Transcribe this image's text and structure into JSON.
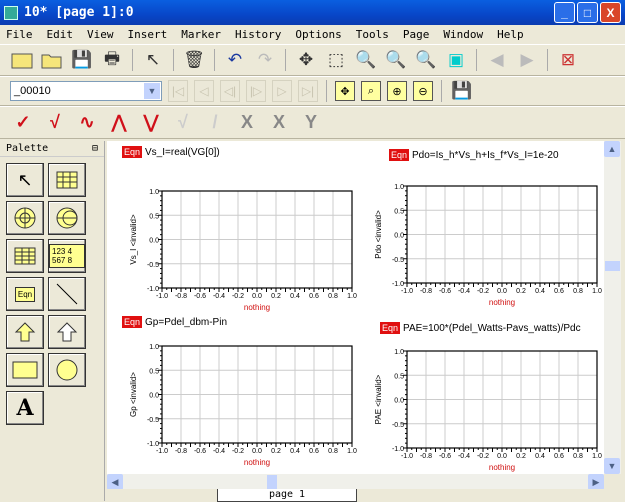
{
  "window": {
    "title": "10* [page 1]:0",
    "minimize": "_",
    "maximize": "□",
    "close": "X"
  },
  "menu": [
    "File",
    "Edit",
    "View",
    "Insert",
    "Marker",
    "History",
    "Options",
    "Tools",
    "Page",
    "Window",
    "Help"
  ],
  "toolbar2": {
    "dataset_value": "_00010"
  },
  "palette": {
    "title": "Palette",
    "pin": "⊟",
    "eqn_label": "Eqn",
    "table_label": "123 4 567 8",
    "text_tool": "A"
  },
  "equations": [
    {
      "tag": "Eqn",
      "text": "Vs_I=real(VG[0])"
    },
    {
      "tag": "Eqn",
      "text": "Pdo=Is_h*Vs_h+Is_f*Vs_I=1e-20"
    },
    {
      "tag": "Eqn",
      "text": "Gp=Pdel_dbm-Pin"
    },
    {
      "tag": "Eqn",
      "text": "PAE=100*(Pdel_Watts-Pavs_watts)/Pdc"
    }
  ],
  "chart_data": [
    {
      "type": "line",
      "ylabel": "Vs_I <invalid>",
      "xlabel": "nothing",
      "xlim": [
        -1,
        1
      ],
      "ylim": [
        -1,
        1
      ],
      "xticks": [
        "-1.0",
        "-0.8",
        "-0.6",
        "-0.4",
        "-0.2",
        "0.0",
        "0.2",
        "0.4",
        "0.6",
        "0.8",
        "1.0"
      ],
      "yticks": [
        "1.0",
        "0.5",
        "0.0",
        "-0.5",
        "-1.0"
      ],
      "grid": true,
      "series": []
    },
    {
      "type": "line",
      "ylabel": "Pdo <invalid>",
      "xlabel": "nothing",
      "xlim": [
        -1,
        1
      ],
      "ylim": [
        -1,
        1
      ],
      "xticks": [
        "-1.0",
        "-0.8",
        "-0.6",
        "-0.4",
        "-0.2",
        "0.0",
        "0.2",
        "0.4",
        "0.6",
        "0.8",
        "1.0"
      ],
      "yticks": [
        "1.0",
        "0.5",
        "0.0",
        "-0.5",
        "-1.0"
      ],
      "grid": true,
      "series": []
    },
    {
      "type": "line",
      "ylabel": "Gp <invalid>",
      "xlabel": "nothing",
      "xlim": [
        -1,
        1
      ],
      "ylim": [
        -1,
        1
      ],
      "xticks": [
        "-1.0",
        "-0.8",
        "-0.6",
        "-0.4",
        "-0.2",
        "0.0",
        "0.2",
        "0.4",
        "0.6",
        "0.8",
        "1.0"
      ],
      "yticks": [
        "1.0",
        "0.5",
        "0.0",
        "-0.5",
        "-1.0"
      ],
      "grid": true,
      "series": []
    },
    {
      "type": "line",
      "ylabel": "PAE <invalid>",
      "xlabel": "nothing",
      "xlim": [
        -1,
        1
      ],
      "ylim": [
        -1,
        1
      ],
      "xticks": [
        "-1.0",
        "-0.8",
        "-0.6",
        "-0.4",
        "-0.2",
        "0.0",
        "0.2",
        "0.4",
        "0.6",
        "0.8",
        "1.0"
      ],
      "yticks": [
        "1.0",
        "0.5",
        "0.0",
        "-0.5",
        "-1.0"
      ],
      "grid": true,
      "series": []
    }
  ],
  "tabs": [
    {
      "label": "page 1"
    }
  ]
}
